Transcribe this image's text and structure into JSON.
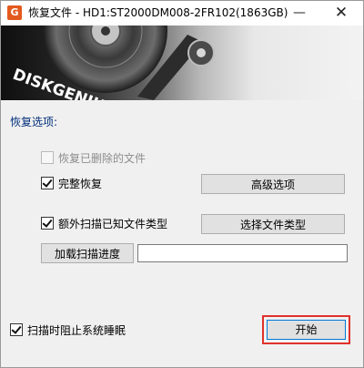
{
  "window": {
    "title": "恢复文件 - HD1:ST2000DM008-2FR102(1863GB)",
    "app_icon_glyph": "G",
    "minimize_glyph": "—",
    "close_glyph": "✕"
  },
  "banner": {
    "brand": "DISKGENIUS"
  },
  "options": {
    "section_label": "恢复选项:",
    "recover_deleted": {
      "label": "恢复已删除的文件",
      "checked": false,
      "enabled": false
    },
    "full_recovery": {
      "label": "完整恢复",
      "checked": true,
      "enabled": true
    },
    "advanced_button": "高级选项",
    "extra_scan": {
      "label": "额外扫描已知文件类型",
      "checked": true,
      "enabled": true
    },
    "select_types_button": "选择文件类型",
    "load_progress_button": "加载扫描进度",
    "load_progress_path": ""
  },
  "footer": {
    "prevent_sleep": {
      "label": "扫描时阻止系统睡眠",
      "checked": true
    },
    "start_button": "开始"
  },
  "colors": {
    "section_label": "#002e7a",
    "highlight": "#e0312c",
    "focus_border": "#0078d7"
  }
}
